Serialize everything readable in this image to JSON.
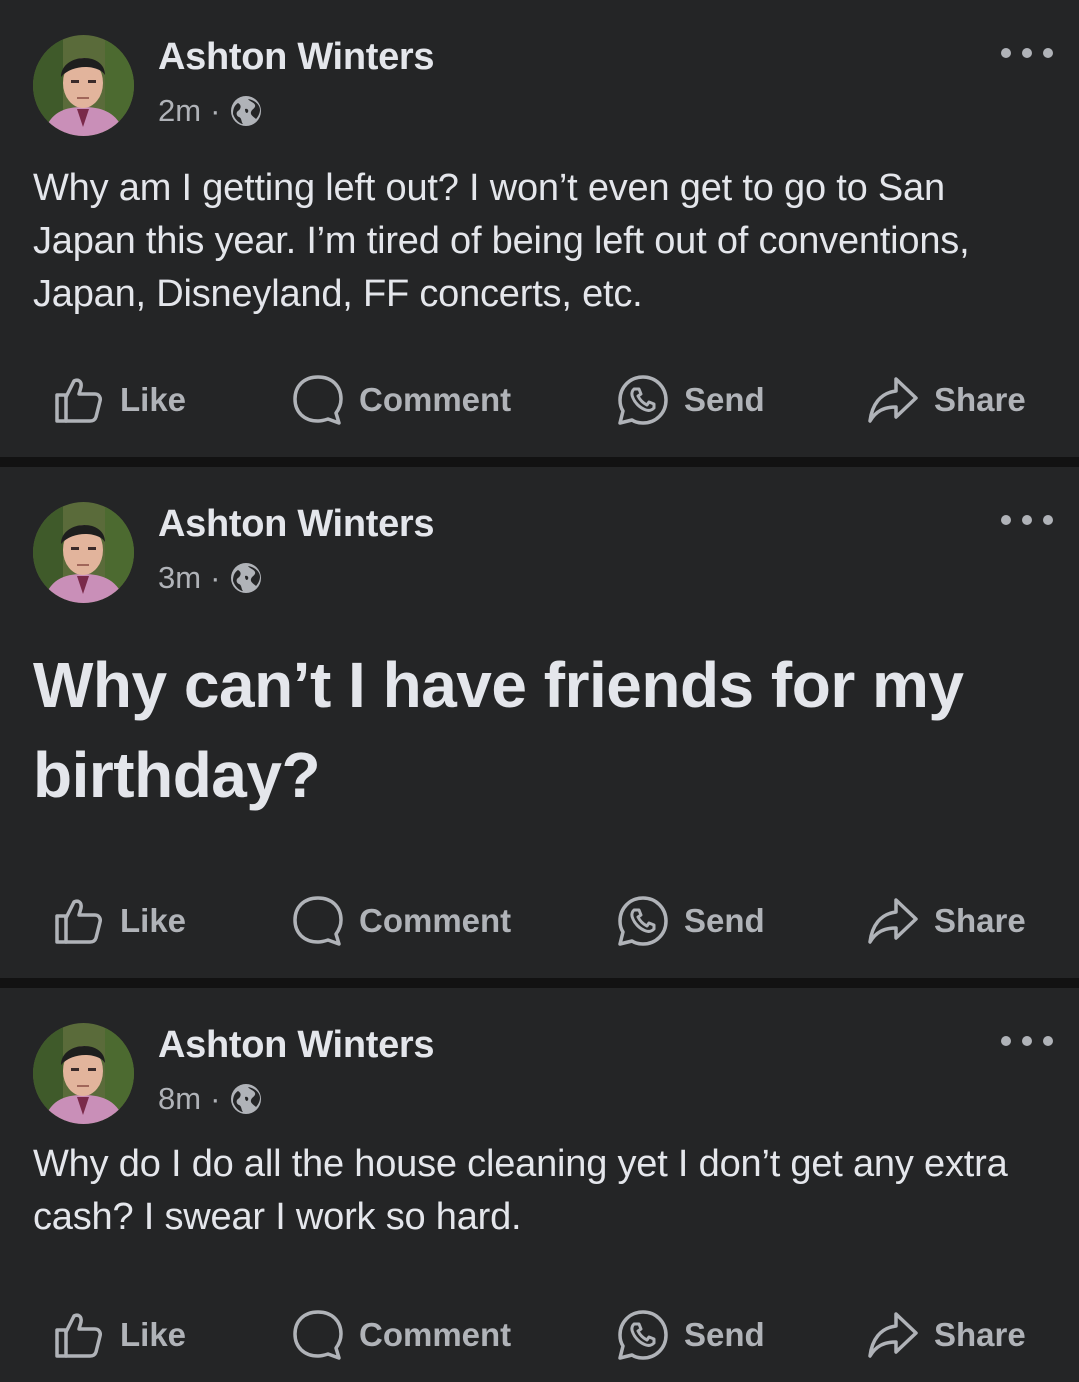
{
  "posts": [
    {
      "author": "Ashton Winters",
      "time": "2m",
      "separator": "·",
      "privacy_icon": "globe-icon",
      "text": "Why am I getting left out?  I won’t even get to go to San Japan this year.  I’m tired of being left out of conventions, Japan, Disneyland, FF concerts, etc.",
      "text_style": "normal",
      "actions": {
        "like": "Like",
        "comment": "Comment",
        "send": "Send",
        "share": "Share"
      }
    },
    {
      "author": "Ashton Winters",
      "time": "3m",
      "separator": "·",
      "privacy_icon": "globe-icon",
      "text": "Why can’t I have friends for my birthday?",
      "text_style": "large",
      "actions": {
        "like": "Like",
        "comment": "Comment",
        "send": "Send",
        "share": "Share"
      }
    },
    {
      "author": "Ashton Winters",
      "time": "8m",
      "separator": "·",
      "privacy_icon": "globe-icon",
      "text": "Why do I do all the house cleaning yet I don’t get any extra cash? I swear I work so hard.",
      "text_style": "normal",
      "actions": {
        "like": "Like",
        "comment": "Comment",
        "send": "Send",
        "share": "Share"
      }
    }
  ],
  "colors": {
    "background": "#121212",
    "card": "#242526",
    "primary_text": "#e4e6eb",
    "secondary_text": "#b0b3b8"
  }
}
